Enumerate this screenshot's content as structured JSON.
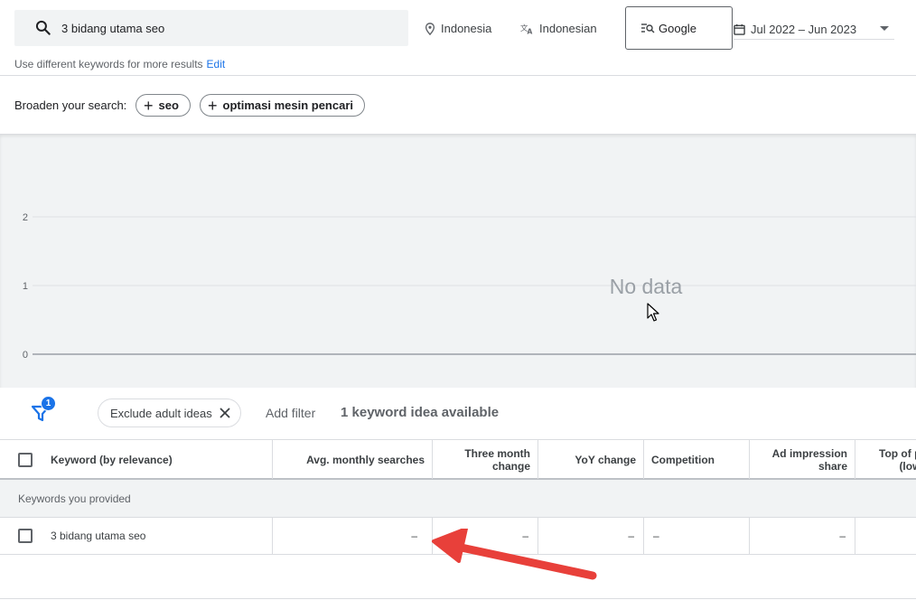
{
  "header": {
    "search_value": "3 bidang utama seo",
    "location": "Indonesia",
    "language": "Indonesian",
    "network": "Google",
    "date_range": "Jul 2022 – Jun 2023",
    "hint_text": "Use different keywords for more results",
    "hint_edit": "Edit"
  },
  "broaden": {
    "label": "Broaden your search:",
    "chips": [
      "seo",
      "optimasi mesin pencari"
    ]
  },
  "chart_data": {
    "type": "line",
    "y_ticks": [
      "2",
      "1",
      "0"
    ],
    "ylim": [
      0,
      2
    ],
    "empty_message": "No data",
    "series": []
  },
  "filters": {
    "badge_count": "1",
    "exclude_chip": "Exclude adult ideas",
    "add_filter": "Add filter",
    "result_count": "1 keyword idea available"
  },
  "table": {
    "columns": {
      "keyword": "Keyword (by relevance)",
      "avg": "Avg. monthly searches",
      "three_month_1": "Three month",
      "three_month_2": "change",
      "yoy": "YoY change",
      "competition": "Competition",
      "ad_imp_1": "Ad impression",
      "ad_imp_2": "share",
      "top_1": "Top of p",
      "top_2": "(low"
    },
    "group_label": "Keywords you provided",
    "rows": [
      {
        "keyword": "3 bidang utama seo",
        "avg": "–",
        "three_month": "–",
        "yoy": "–",
        "competition": "–",
        "ad_imp": "–"
      }
    ]
  },
  "colors": {
    "accent": "#1a73e8",
    "annotation_arrow": "#e8403a"
  }
}
